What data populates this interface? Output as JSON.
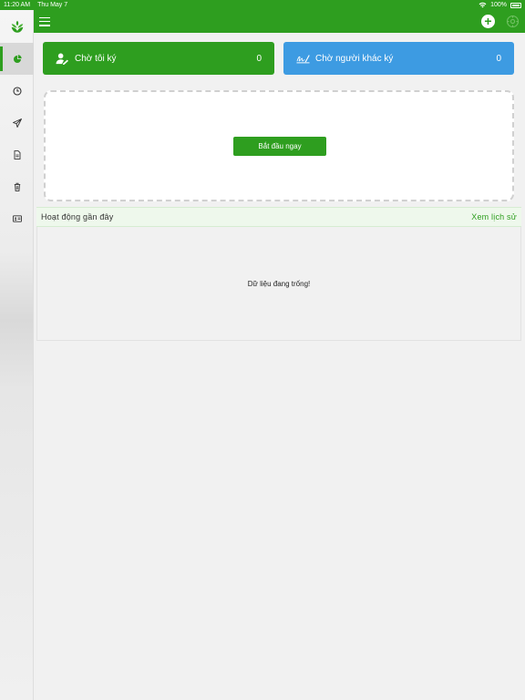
{
  "status_bar": {
    "time": "11:20 AM",
    "date": "Thu May 7",
    "battery": "100%"
  },
  "sidebar": {
    "items": [
      {
        "icon": "pie-chart-icon",
        "active": true
      },
      {
        "icon": "clock-icon",
        "active": false
      },
      {
        "icon": "send-icon",
        "active": false
      },
      {
        "icon": "document-icon",
        "active": false
      },
      {
        "icon": "trash-icon",
        "active": false
      },
      {
        "icon": "id-card-icon",
        "active": false
      }
    ]
  },
  "cards": {
    "waiting_me": {
      "label": "Chờ tôi ký",
      "count": "0",
      "color": "#2e9e1f"
    },
    "waiting_others": {
      "label": "Chờ người khác ký",
      "count": "0",
      "color": "#3d9be2"
    }
  },
  "start": {
    "button_label": "Bắt đầu ngay"
  },
  "activity": {
    "title": "Hoạt động gần đây",
    "history_link": "Xem lịch sử",
    "empty_text": "Dữ liệu đang trống!"
  },
  "colors": {
    "brand": "#2e9e1f",
    "accent_blue": "#3d9be2"
  }
}
